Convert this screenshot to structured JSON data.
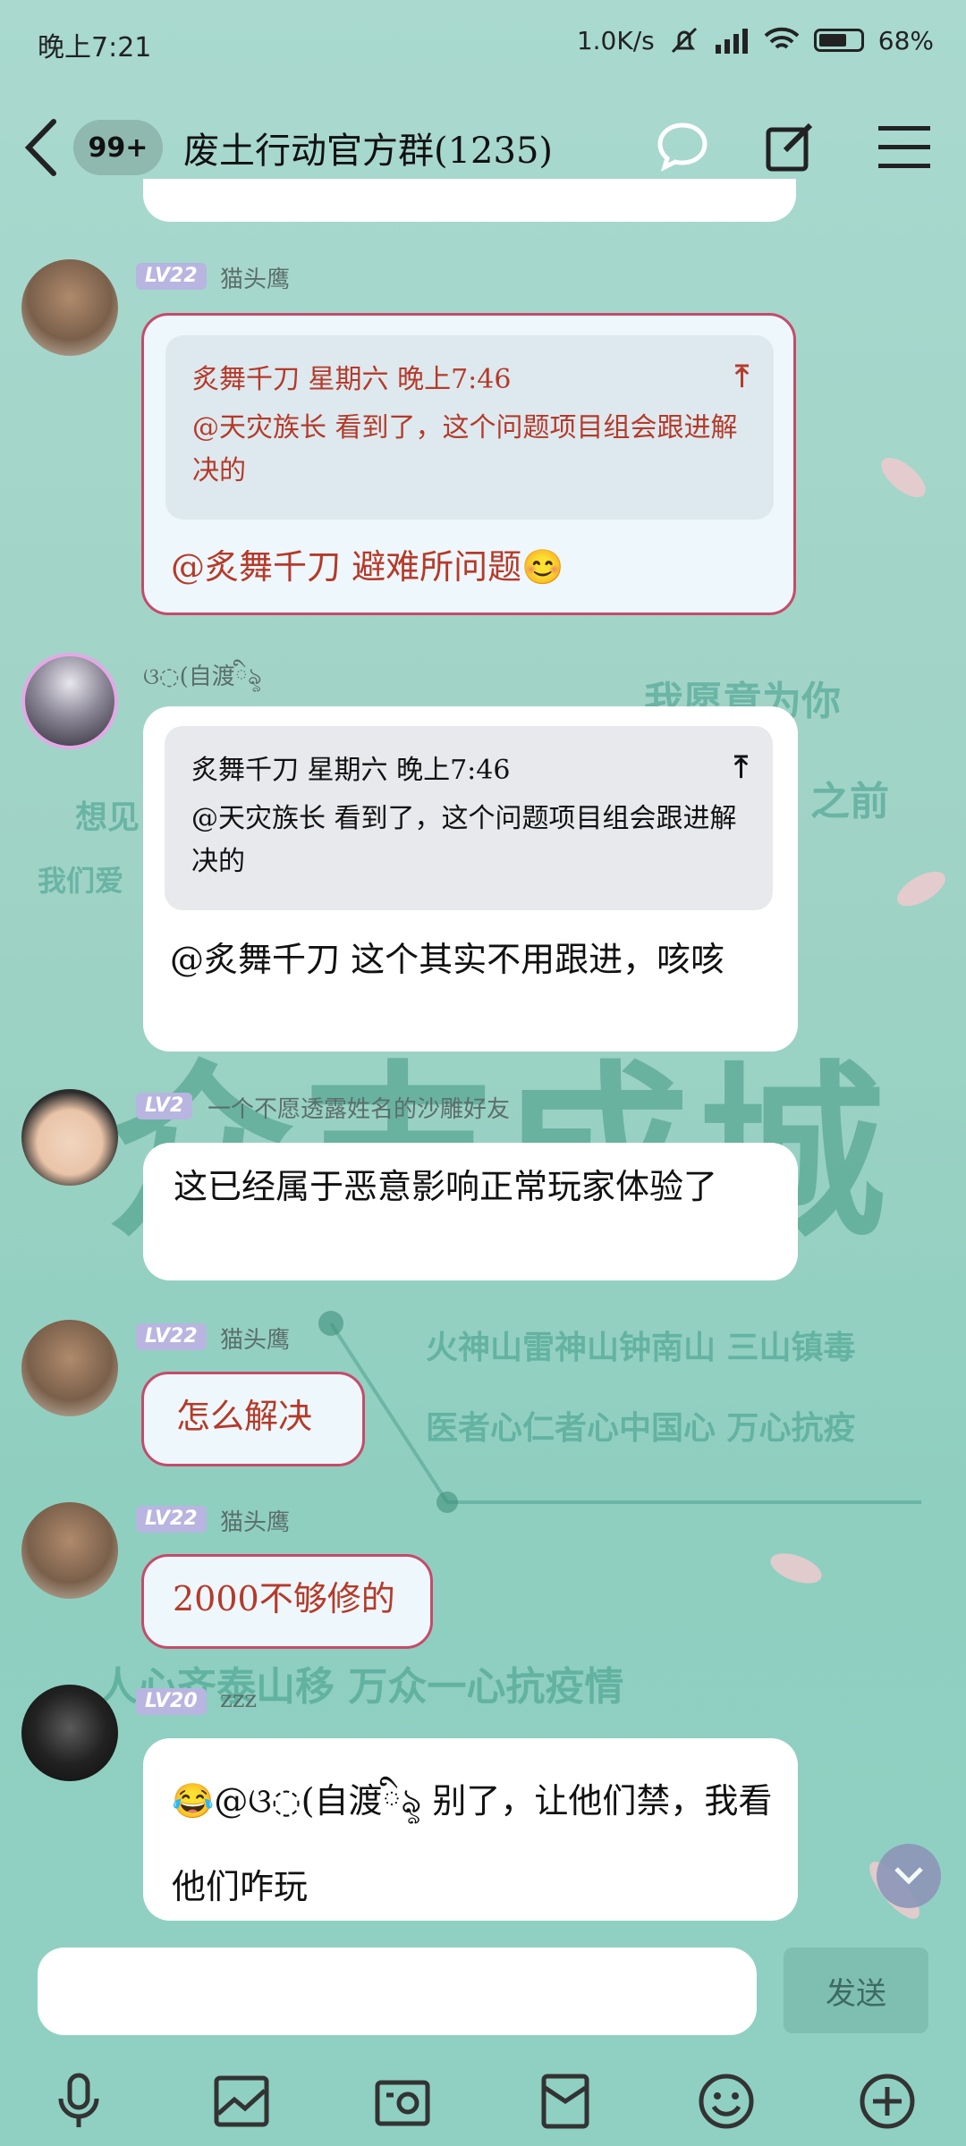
{
  "status": {
    "time": "晚上7:21",
    "speed": "1.0K/s",
    "battery": "68%",
    "battery_level": 0.68
  },
  "header": {
    "unread_badge": "99+",
    "title": "废土行动官方群(1235)"
  },
  "background": {
    "line1": "我愿意为你",
    "line2": "之前",
    "line3": "想见",
    "line4": "我们爱",
    "line5": "众志成城",
    "line6": "火神山雷神山钟南山 三山镇毒",
    "line7": "医者心仁者心中国心 万心抗疫",
    "line8": "人心齐泰山移 万众一心抗疫情"
  },
  "messages": [
    {
      "level": "LV22",
      "nick": "猫头鹰",
      "quote_head": "炙舞千刀 星期六 晚上7:46",
      "quote_body": "@天灾族长 看到了，这个问题项目组会跟进解决的",
      "text": "@炙舞千刀 避难所问题😊"
    },
    {
      "level": "",
      "nick": "ଓ◌(自渡ིৡ",
      "quote_head": "炙舞千刀 星期六 晚上7:46",
      "quote_body": "@天灾族长 看到了，这个问题项目组会跟进解决的",
      "text": "@炙舞千刀 这个其实不用跟进，咳咳"
    },
    {
      "level": "LV2",
      "nick": "一个不愿透露姓名的沙雕好友",
      "text": "这已经属于恶意影响正常玩家体验了"
    },
    {
      "level": "LV22",
      "nick": "猫头鹰",
      "text": "怎么解决"
    },
    {
      "level": "LV22",
      "nick": "猫头鹰",
      "text": "2000不够修的"
    },
    {
      "level": "LV20",
      "nick": "zzz",
      "text": "😂@ଓ◌(自渡ིৡ 别了，让他们禁，我看他们咋玩"
    }
  ],
  "composer": {
    "placeholder": "",
    "send_label": "发送"
  },
  "icons": {
    "back": "chevron-left-icon",
    "chat": "chat-bubble-icon",
    "edit": "edit-icon",
    "menu": "menu-icon",
    "voice": "microphone-icon",
    "image": "image-icon",
    "camera": "camera-icon",
    "redpacket": "red-packet-icon",
    "emoji": "emoji-icon",
    "more": "plus-circle-icon"
  }
}
